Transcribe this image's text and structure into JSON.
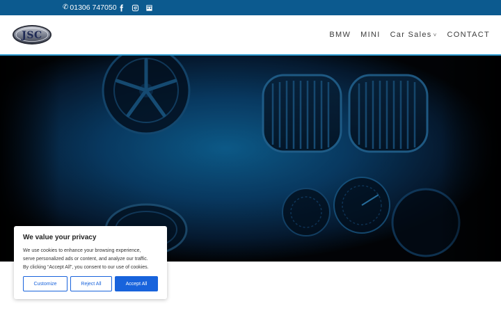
{
  "topbar": {
    "phone": "01306 747050",
    "phone_icon": "phone-icon",
    "socials": [
      "facebook-icon",
      "instagram-icon",
      "flickr-icon"
    ],
    "bg_color": "#0c5a8f"
  },
  "header": {
    "logo_text": "JSC",
    "nav": [
      {
        "label": "BMW"
      },
      {
        "label": "MINI"
      },
      {
        "label": "Car Sales",
        "has_dropdown": true
      },
      {
        "label": "CONTACT"
      }
    ],
    "accent_color": "#2f9bd0"
  },
  "cookie": {
    "title": "We value your privacy",
    "text_lines": [
      "We use cookies to enhance your browsing experience,",
      "serve personalized ads or content, and analyze our traffic.",
      "By clicking “Accept All”, you consent to our use of cookies."
    ],
    "customize": "Customize",
    "reject": "Reject All",
    "accept": "Accept All",
    "button_color": "#1863dc"
  }
}
